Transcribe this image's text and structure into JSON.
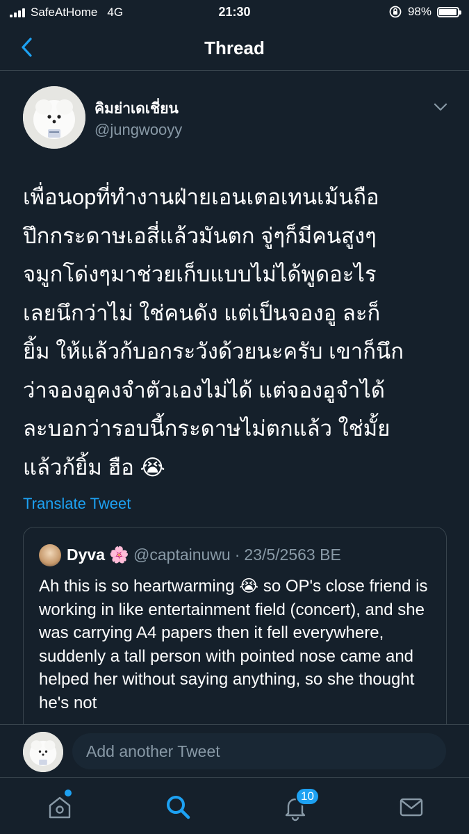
{
  "status_bar": {
    "carrier": "SafeAtHome",
    "network": "4G",
    "time": "21:30",
    "battery_percent": "98%",
    "battery_level": 0.98
  },
  "nav": {
    "title": "Thread",
    "back_icon": "chevron-left-icon"
  },
  "tweet": {
    "author_name": "คิมย่าเดเชี่ยน",
    "author_handle": "@jungwooyy",
    "text": "เพื่อนopที่ทำงานฝ่ายเอนเตอเทนเม้นถือ\nปึกกระดาษเอสี่แล้วมันตก จู่ๆก็มีคนสูงๆ\nจมูกโด่งๆมาช่วยเก็บแบบไม่ได้พูดอะไร\nเลยนึกว่าไม่ ใช่คนดัง แต่เป็นจองอู ละก็\nยิ้ม ให้แล้วก้บอกระวังด้วยนะครับ เขาก็นึก\nว่าจองอูคงจำตัวเองไม่ได้ แต่จองอูจำได้\nละบอกว่ารอบนี้กระดาษไม่ตกแล้ว ใช่มั้ย\nแล้วก้ยิ้ม ฮือ 😭",
    "translate_label": "Translate Tweet"
  },
  "quote": {
    "author_name": "Dyva 🌸",
    "author_handle": "@captainuwu",
    "separator": "·",
    "date": "23/5/2563 BE",
    "text": "Ah this is so heartwarming 😭  so OP's close friend is working in like entertainment field (concert), and she was carrying A4 papers then it fell everywhere, suddenly a tall person with pointed nose came and helped her without saying anything, so she thought he's not"
  },
  "compose": {
    "placeholder": "Add another Tweet"
  },
  "tabs": [
    {
      "name": "home",
      "icon": "home-icon",
      "has_dot": true
    },
    {
      "name": "search",
      "icon": "search-icon",
      "active": true
    },
    {
      "name": "notifications",
      "icon": "bell-icon",
      "badge": "10"
    },
    {
      "name": "messages",
      "icon": "mail-icon"
    }
  ],
  "colors": {
    "background": "#15202b",
    "accent": "#1da1f2",
    "secondary_text": "#8899a6",
    "border": "#38444d"
  }
}
